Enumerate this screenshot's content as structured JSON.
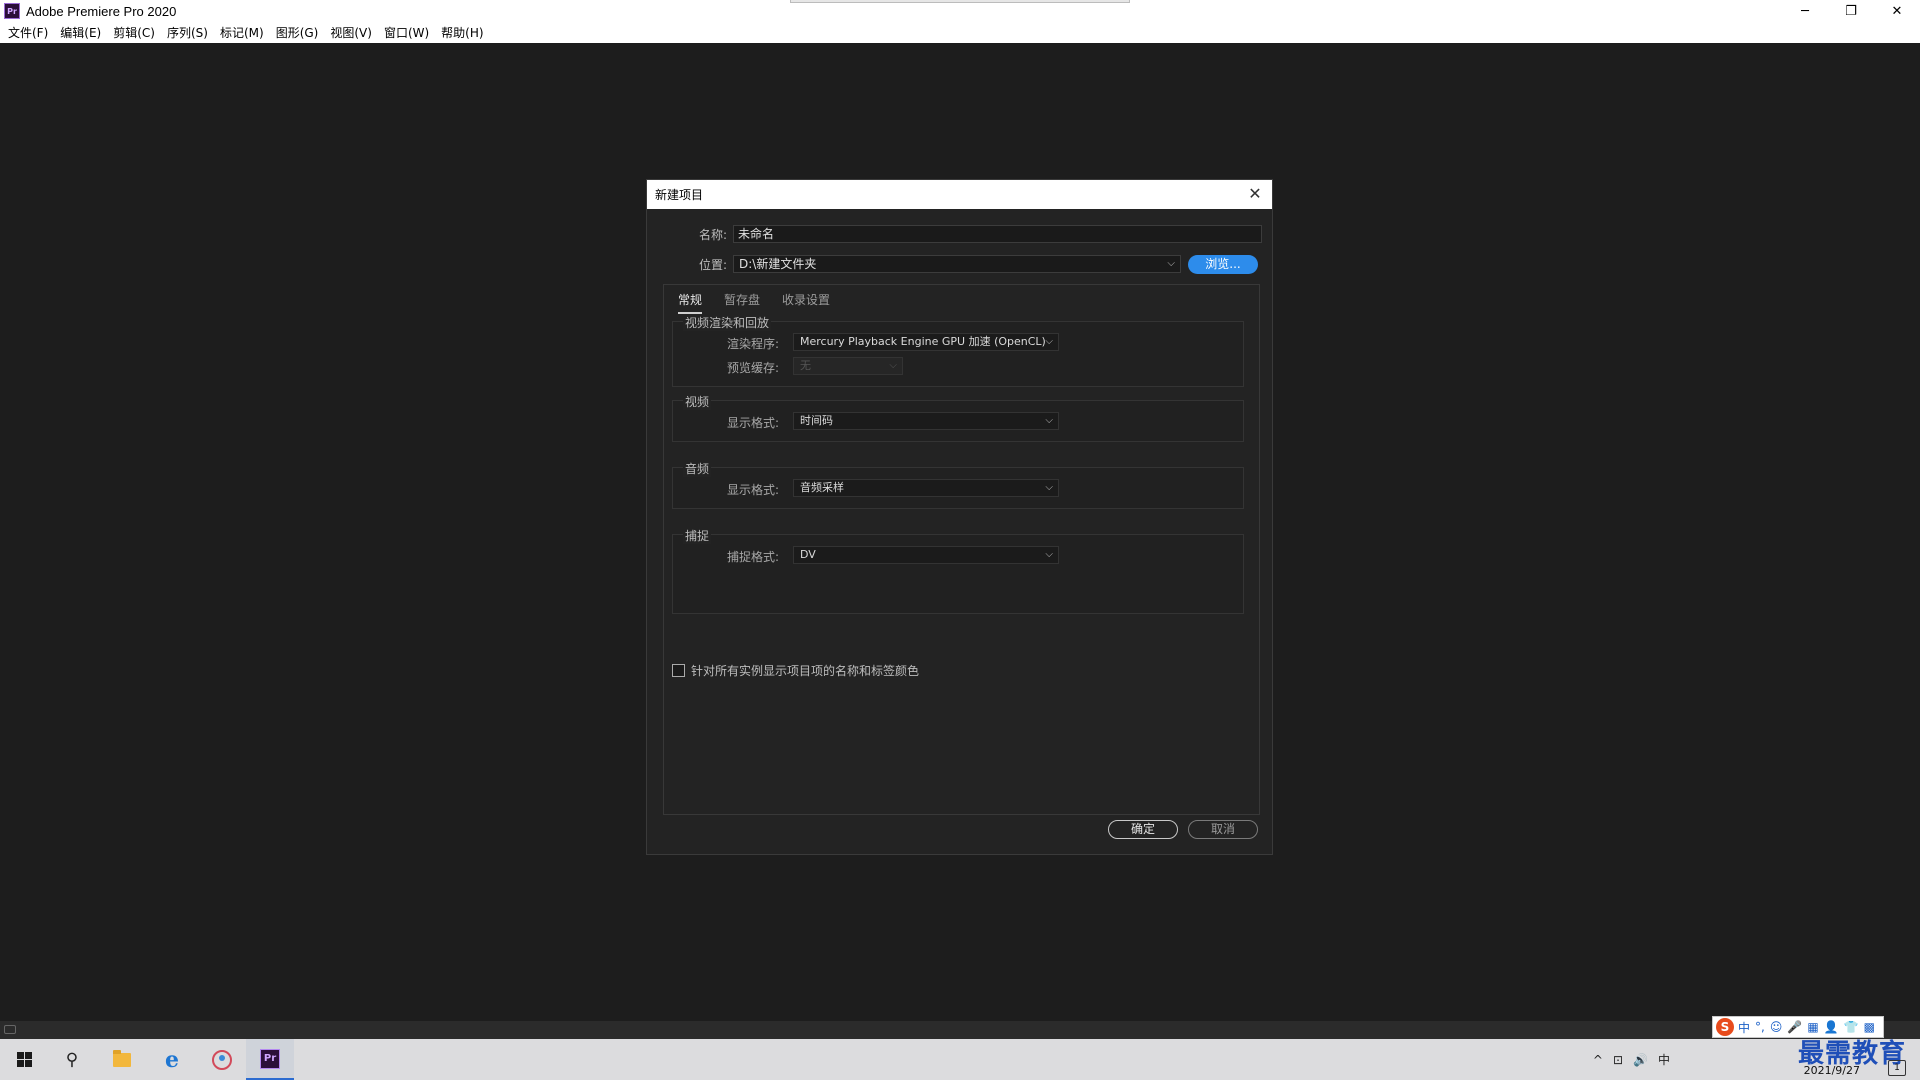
{
  "app": {
    "title": "Adobe Premiere Pro 2020",
    "icon_text": "Pr",
    "window_controls": [
      "─",
      "❐",
      "✕"
    ]
  },
  "menu": [
    "文件(F)",
    "编辑(E)",
    "剪辑(C)",
    "序列(S)",
    "标记(M)",
    "图形(G)",
    "视图(V)",
    "窗口(W)",
    "帮助(H)"
  ],
  "dialog": {
    "title": "新建项目",
    "name_label": "名称:",
    "name_value": "未命名",
    "location_label": "位置:",
    "location_value": "D:\\新建文件夹",
    "browse_label": "浏览...",
    "tabs": [
      "常规",
      "暂存盘",
      "收录设置"
    ],
    "groups": {
      "render": {
        "title": "视频渲染和回放",
        "renderer_label": "渲染程序:",
        "renderer_value": "Mercury Playback Engine GPU 加速 (OpenCL)",
        "preview_cache_label": "预览缓存:",
        "preview_cache_value": "无"
      },
      "video": {
        "title": "视频",
        "display_format_label": "显示格式:",
        "display_format_value": "时间码"
      },
      "audio": {
        "title": "音频",
        "display_format_label": "显示格式:",
        "display_format_value": "音频采样"
      },
      "capture": {
        "title": "捕捉",
        "capture_format_label": "捕捉格式:",
        "capture_format_value": "DV"
      }
    },
    "checkbox_label": "针对所有实例显示项目项的名称和标签颜色",
    "checkbox_checked": false,
    "ok_label": "确定",
    "cancel_label": "取消"
  },
  "taskbar": {
    "apps": [
      "start",
      "search",
      "file-explorer",
      "edge",
      "paint-3d",
      "premiere-pro"
    ],
    "pr_label": "Pr",
    "clock_date": "2021/9/27",
    "notification_count": "1",
    "tray": [
      "^",
      "⊡",
      "🔊",
      "中"
    ]
  },
  "ime": {
    "logo": "S",
    "items": [
      "中",
      "°,",
      "☺",
      "🎤",
      "▦",
      "👤",
      "👕",
      "▩"
    ]
  },
  "watermark": "最需教育",
  "colors": {
    "accent": "#2d8ceb",
    "workspace": "#1d1d1d",
    "dialog_bg": "#232323"
  }
}
